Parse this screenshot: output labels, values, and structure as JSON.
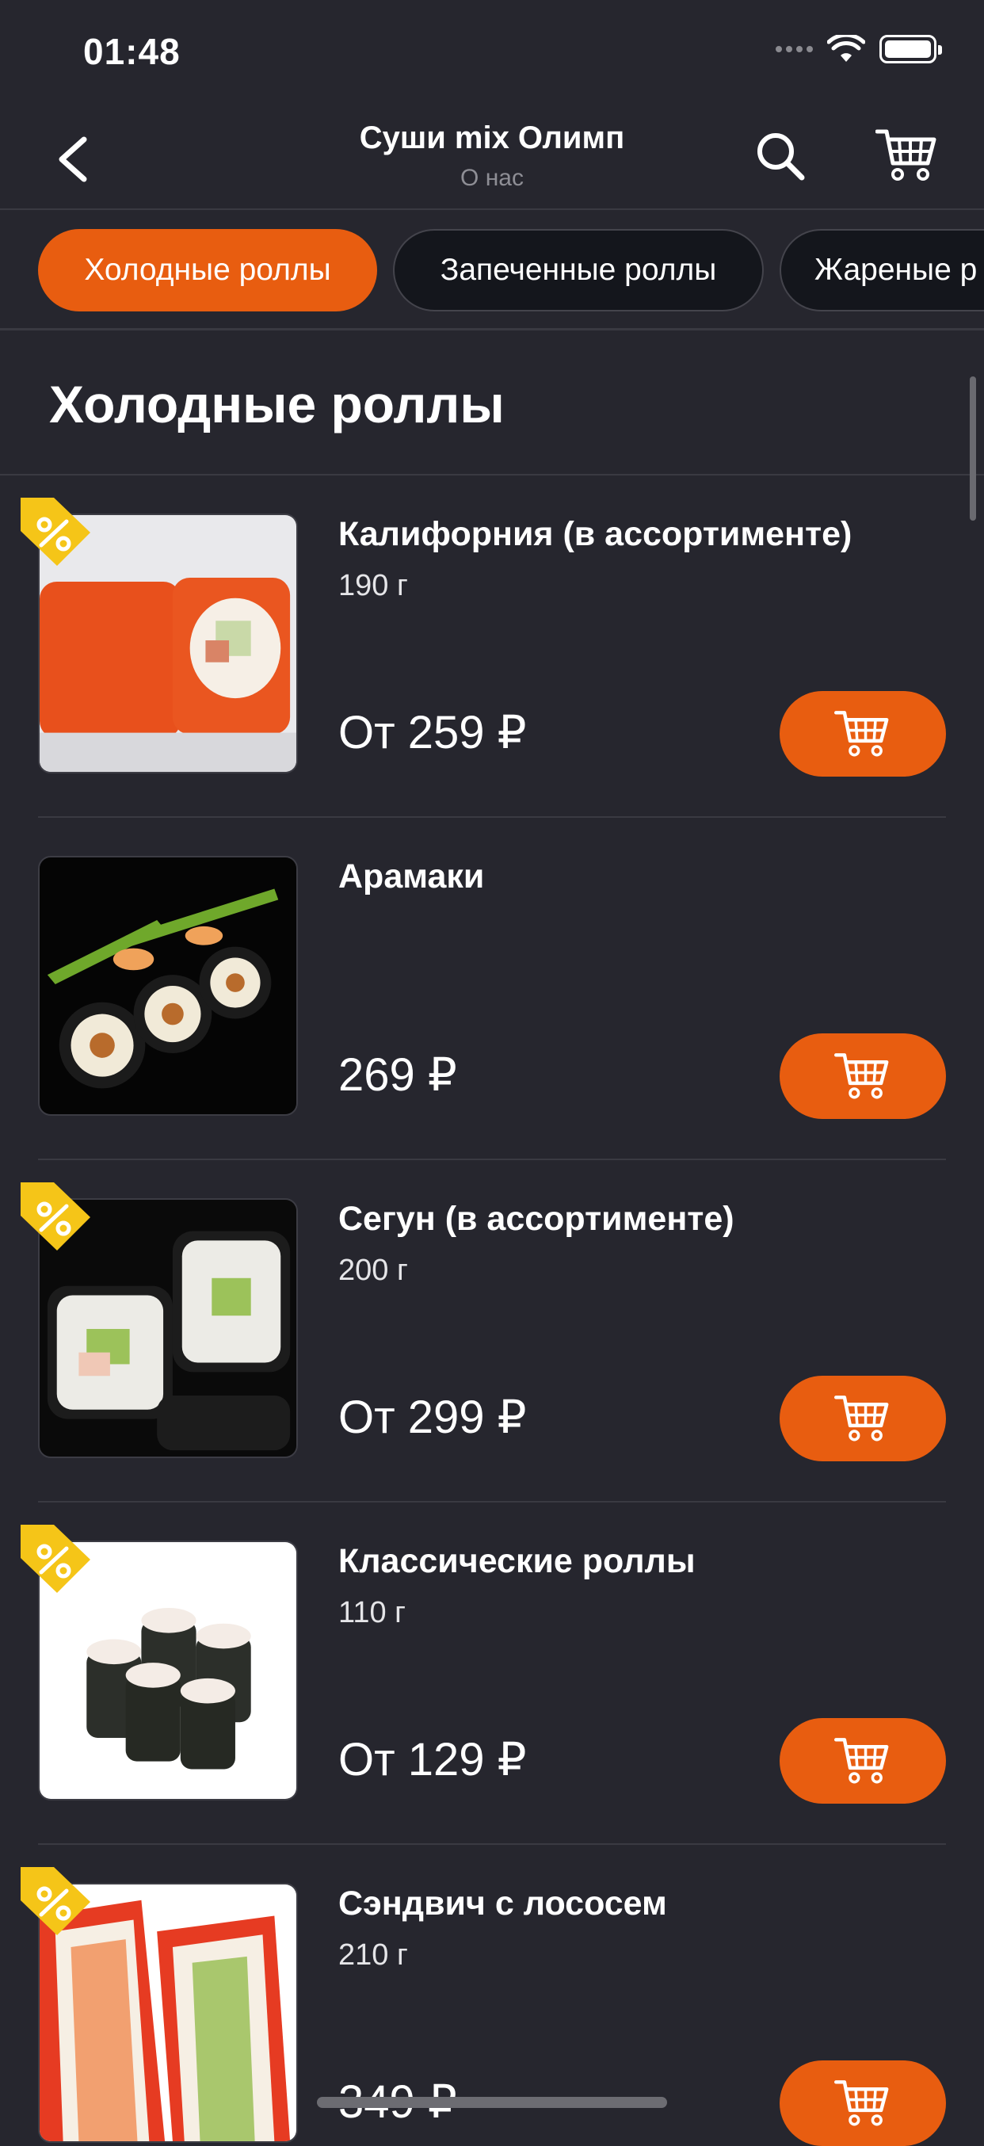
{
  "status_bar": {
    "time": "01:48"
  },
  "header": {
    "title": "Суши mix Олимп",
    "subtitle": "О нас"
  },
  "tabs": [
    {
      "label": "Холодные роллы"
    },
    {
      "label": "Запеченные роллы"
    },
    {
      "label": "Жареные р"
    }
  ],
  "section": {
    "title": "Холодные роллы"
  },
  "products": [
    {
      "name": "Калифорния (в ассортименте)",
      "weight": "190 г",
      "price": "От 259 ₽"
    },
    {
      "name": "Арамаки",
      "weight": "",
      "price": "269 ₽"
    },
    {
      "name": "Сегун (в ассортименте)",
      "weight": "200 г",
      "price": "От 299 ₽"
    },
    {
      "name": "Классические роллы",
      "weight": "110 г",
      "price": "От 129 ₽"
    },
    {
      "name": "Сэндвич с лососем",
      "weight": "210 г",
      "price": "349 ₽"
    }
  ],
  "colors": {
    "accent": "#e85d10",
    "background": "#26262e",
    "discount_tag": "#f5c518"
  }
}
